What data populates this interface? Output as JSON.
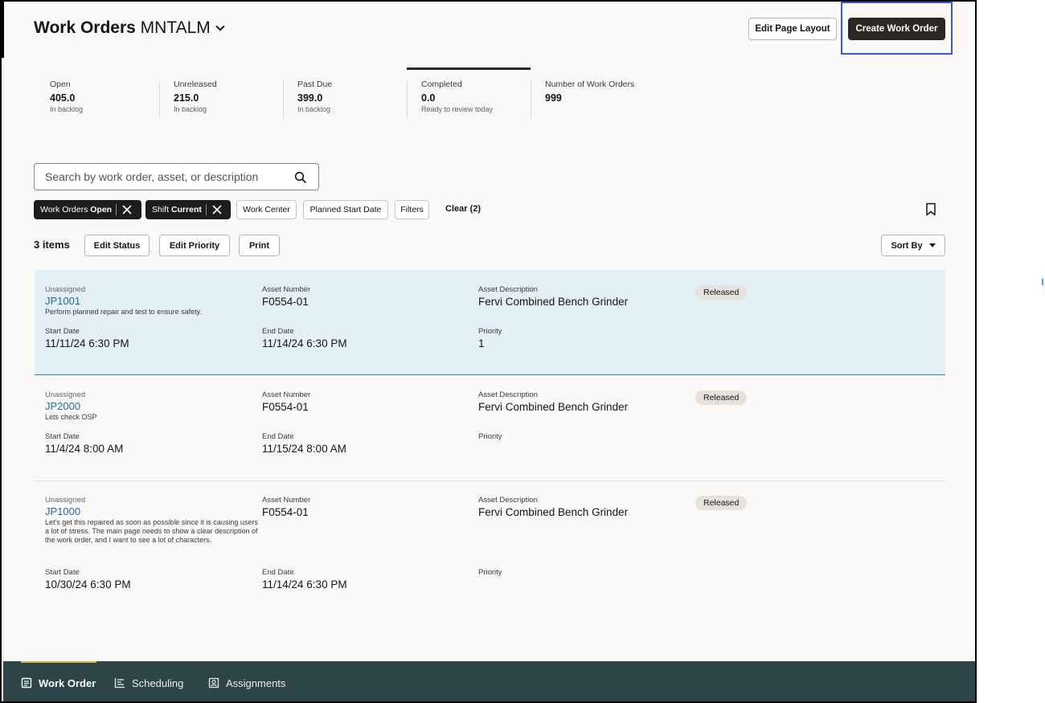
{
  "header": {
    "title_bold": "Work Orders",
    "title_org": "MNTALM",
    "edit_layout_label": "Edit Page Layout",
    "create_label": "Create Work Order"
  },
  "summary": [
    {
      "label": "Open",
      "value": "405.0",
      "sub": "In backlog"
    },
    {
      "label": "Unreleased",
      "value": "215.0",
      "sub": "In backlog"
    },
    {
      "label": "Past Due",
      "value": "399.0",
      "sub": "In backlog"
    },
    {
      "label": "Completed",
      "value": "0.0",
      "sub": "Ready to review today",
      "active": true
    },
    {
      "label": "Number of Work Orders",
      "value": "999",
      "sub": ""
    }
  ],
  "search": {
    "placeholder": "Search by work order, asset, or description",
    "value": ""
  },
  "filters": {
    "chip1_prefix": "Work Orders",
    "chip1_value": "Open",
    "chip2_prefix": "Shift",
    "chip2_value": "Current",
    "work_center": "Work Center",
    "planned_start": "Planned Start Date",
    "filters": "Filters",
    "clear": "Clear (2)"
  },
  "toolbar": {
    "count": "3 items",
    "edit_status": "Edit Status",
    "edit_priority": "Edit Priority",
    "print": "Print",
    "sort_by": "Sort By"
  },
  "labels": {
    "asset_number": "Asset Number",
    "asset_description": "Asset Description",
    "start_date": "Start Date",
    "end_date": "End Date",
    "priority": "Priority"
  },
  "work_orders": [
    {
      "assignee": "Unassigned",
      "id": "JP1001",
      "description": "Perform planned repair and test to ensure safety.",
      "asset_number": "F0554-01",
      "asset_description": "Fervi Combined Bench Grinder",
      "status": "Released",
      "start_date": "11/11/24 6:30 PM",
      "end_date": "11/14/24 6:30 PM",
      "priority": "1"
    },
    {
      "assignee": "Unassigned",
      "id": "JP2000",
      "description": "Lets check OSP",
      "asset_number": "F0554-01",
      "asset_description": "Fervi Combined Bench Grinder",
      "status": "Released",
      "start_date": "11/4/24 8:00 AM",
      "end_date": "11/15/24 8:00 AM",
      "priority": ""
    },
    {
      "assignee": "Unassigned",
      "id": "JP1000",
      "description": "Let's get this repaired as soon as possible since it is causing users a lot of stress. The main page needs to show a clear description of the work order, and I want to see a lot of characters.",
      "asset_number": "F0554-01",
      "asset_description": "Fervi Combined Bench Grinder",
      "status": "Released",
      "start_date": "10/30/24 6:30 PM",
      "end_date": "11/14/24 6:30 PM",
      "priority": ""
    }
  ],
  "bottom_nav": [
    {
      "label": "Work Order",
      "icon": "document-icon",
      "active": true
    },
    {
      "label": "Scheduling",
      "icon": "schedule-list-icon"
    },
    {
      "label": "Assignments",
      "icon": "assignment-person-icon"
    }
  ]
}
